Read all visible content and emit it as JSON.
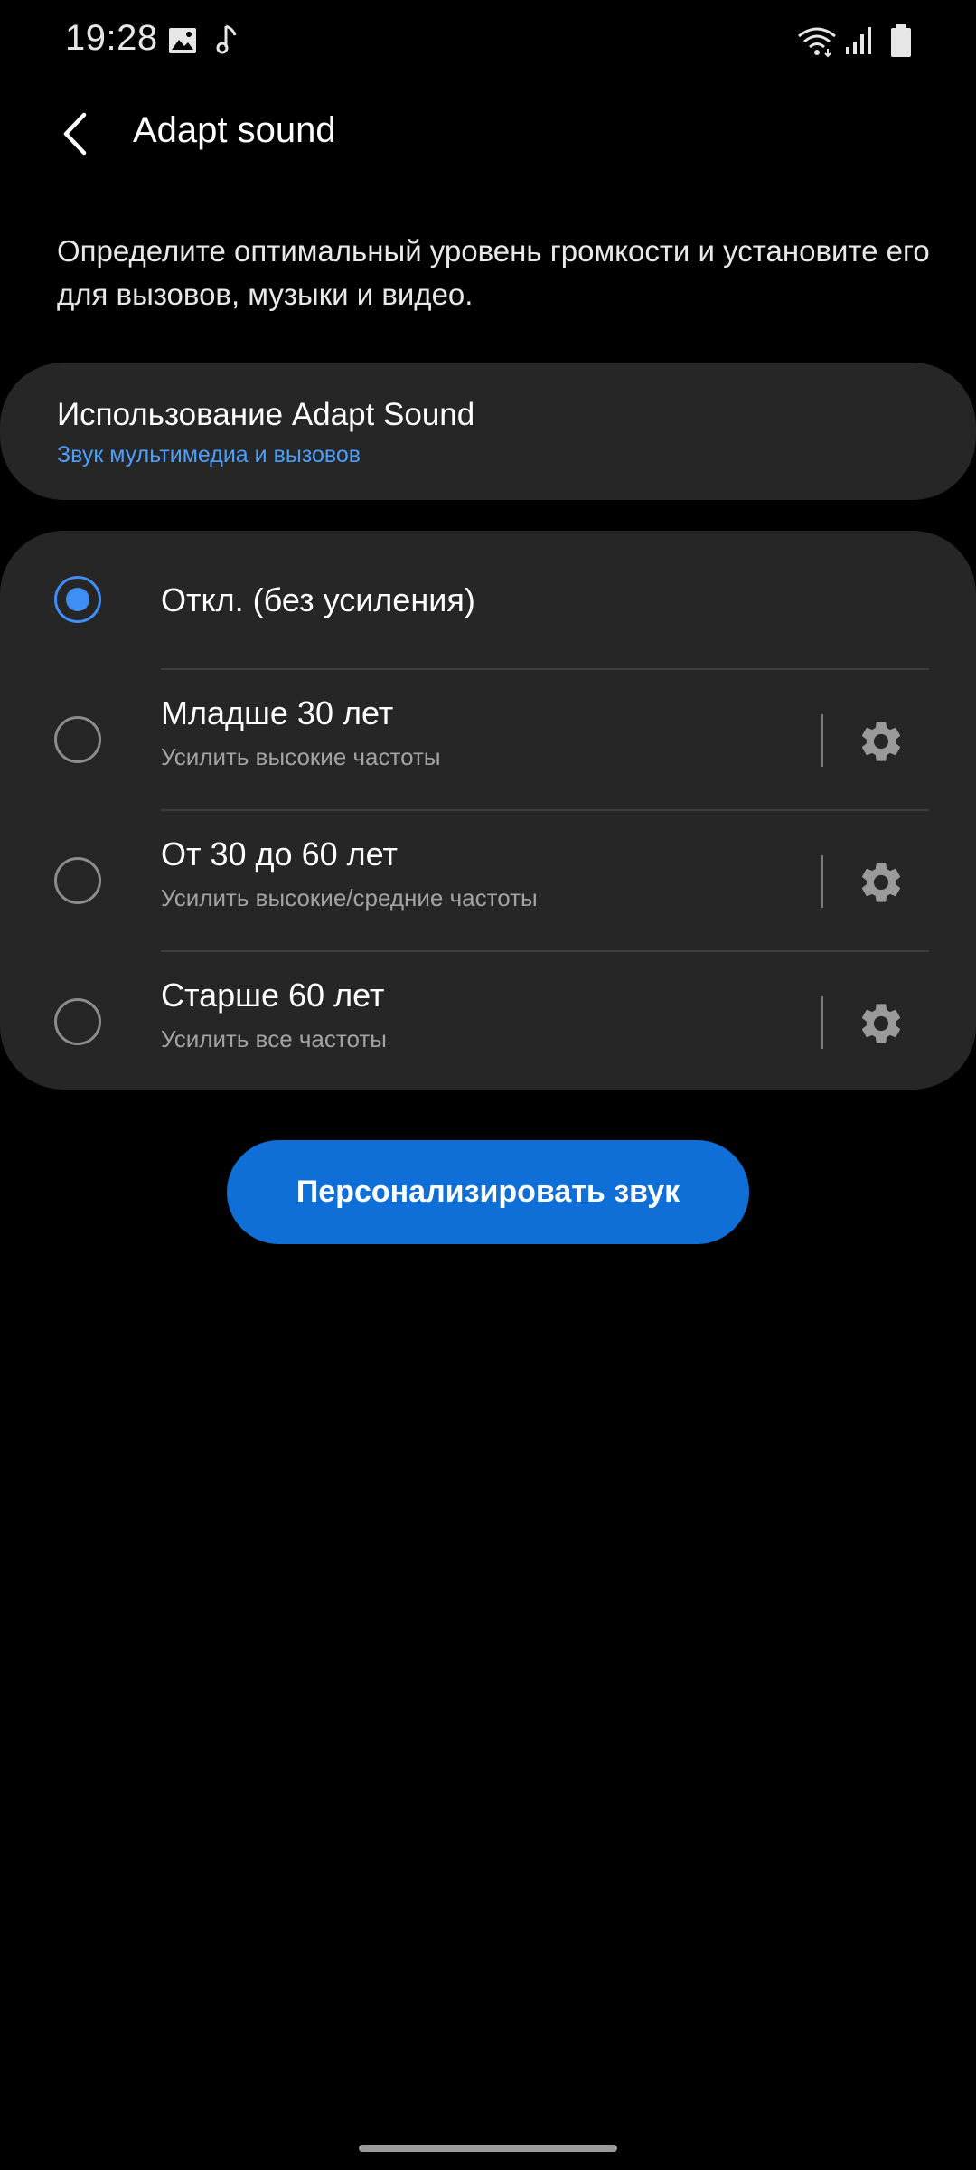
{
  "status_bar": {
    "time": "19:28",
    "icons": [
      "image-icon",
      "music-note-icon",
      "wifi-icon",
      "signal-icon",
      "battery-icon"
    ]
  },
  "header": {
    "back_icon": "back-arrow-icon",
    "title": "Adapt sound"
  },
  "description": "Определите оптимальный уровень громкости и установите его для вызовов, музыки и видео.",
  "usage": {
    "title": "Использование Adapt Sound",
    "subtitle": "Звук мультимедиа и вызовов"
  },
  "options": [
    {
      "title": "Откл. (без усиления)",
      "subtitle": "",
      "selected": true,
      "has_settings": false
    },
    {
      "title": "Младше 30 лет",
      "subtitle": "Усилить высокие частоты",
      "selected": false,
      "has_settings": true
    },
    {
      "title": "От 30 до 60 лет",
      "subtitle": "Усилить высокие/средние частоты",
      "selected": false,
      "has_settings": true
    },
    {
      "title": "Старше 60 лет",
      "subtitle": "Усилить все частоты",
      "selected": false,
      "has_settings": true
    }
  ],
  "actions": {
    "personalize_label": "Персонализировать звук"
  },
  "colors": {
    "background": "#000000",
    "card": "#262626",
    "accent": "#3f8ef5",
    "button": "#0f6fd6",
    "link": "#4c9ef8"
  }
}
